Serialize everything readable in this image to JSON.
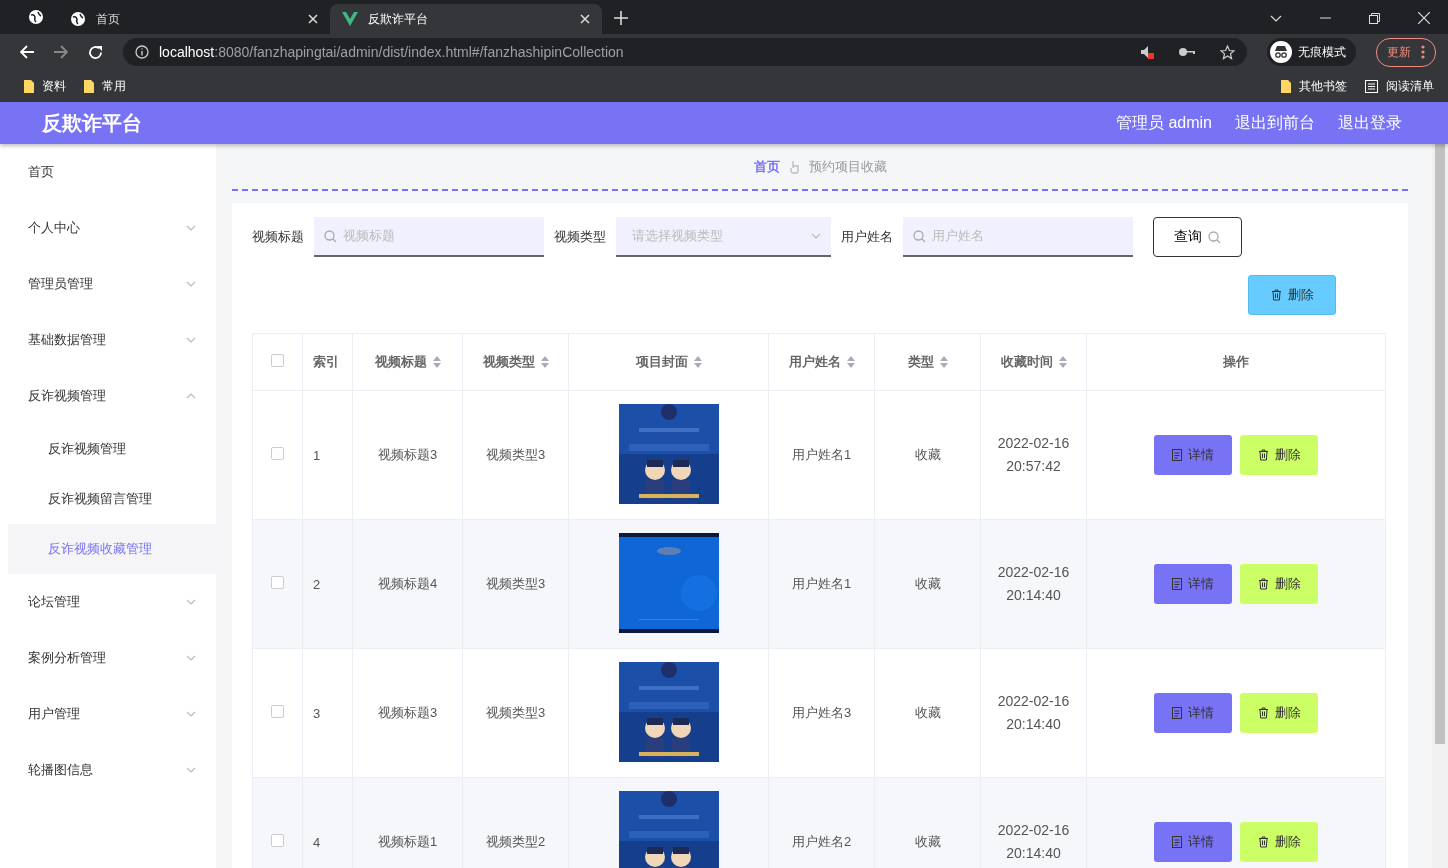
{
  "browser": {
    "tabs": [
      {
        "title": "首页",
        "selected": false
      },
      {
        "title": "反欺诈平台",
        "selected": true
      }
    ],
    "address": {
      "host": "localhost",
      "path": ":8080/fanzhapingtai/admin/dist/index.html#/fanzhashipinCollection"
    },
    "incognito": "无痕模式",
    "update": "更新",
    "bookmarks": [
      "资料",
      "常用"
    ],
    "other_bookmarks": "其他书签",
    "reading_list": "阅读清单"
  },
  "header": {
    "title": "反欺诈平台",
    "links": [
      "管理员 admin",
      "退出到前台",
      "退出登录"
    ]
  },
  "sidebar": {
    "items": [
      {
        "label": "首页",
        "expandable": false
      },
      {
        "label": "个人中心",
        "expandable": true,
        "expanded": false
      },
      {
        "label": "管理员管理",
        "expandable": true,
        "expanded": false
      },
      {
        "label": "基础数据管理",
        "expandable": true,
        "expanded": false
      },
      {
        "label": "反诈视频管理",
        "expandable": true,
        "expanded": true,
        "children": [
          {
            "label": "反诈视频管理",
            "selected": false
          },
          {
            "label": "反诈视频留言管理",
            "selected": false
          },
          {
            "label": "反诈视频收藏管理",
            "selected": true
          }
        ]
      },
      {
        "label": "论坛管理",
        "expandable": true,
        "expanded": false
      },
      {
        "label": "案例分析管理",
        "expandable": true,
        "expanded": false
      },
      {
        "label": "用户管理",
        "expandable": true,
        "expanded": false
      },
      {
        "label": "轮播图信息",
        "expandable": true,
        "expanded": false
      }
    ]
  },
  "breadcrumb": [
    "首页",
    "预约项目收藏"
  ],
  "filters": [
    {
      "label": "视频标题",
      "placeholder": "视频标题",
      "kind": "search"
    },
    {
      "label": "视频类型",
      "placeholder": "请选择视频类型",
      "kind": "select"
    },
    {
      "label": "用户姓名",
      "placeholder": "用户姓名",
      "kind": "search"
    }
  ],
  "query_button": "查询",
  "delete_button": "删除",
  "table": {
    "all_checked": false,
    "columns": [
      {
        "label": "索引",
        "sortable": false
      },
      {
        "label": "视频标题",
        "sortable": true
      },
      {
        "label": "视频类型",
        "sortable": true
      },
      {
        "label": "项目封面",
        "sortable": true
      },
      {
        "label": "用户姓名",
        "sortable": true
      },
      {
        "label": "类型",
        "sortable": true
      },
      {
        "label": "收藏时间",
        "sortable": true
      },
      {
        "label": "操作",
        "sortable": false
      }
    ],
    "rows": [
      {
        "checked": false,
        "index": "1",
        "title": "视频标题3",
        "type": "视频类型3",
        "cover": {
          "kind": "picture"
        },
        "user": "用户姓名1",
        "kind": "收藏",
        "time": [
          "2022-02-16",
          "20:57:42"
        ],
        "actions": [
          "详情",
          "删除"
        ]
      },
      {
        "checked": false,
        "index": "2",
        "title": "视频标题4",
        "type": "视频类型3",
        "cover": {
          "kind": "picture"
        },
        "user": "用户姓名1",
        "kind": "收藏",
        "time": [
          "2022-02-16",
          "20:14:40"
        ],
        "actions": [
          "详情",
          "删除"
        ]
      },
      {
        "checked": false,
        "index": "3",
        "title": "视频标题3",
        "type": "视频类型3",
        "cover": {
          "kind": "picture"
        },
        "user": "用户姓名3",
        "kind": "收藏",
        "time": [
          "2022-02-16",
          "20:14:40"
        ],
        "actions": [
          "详情",
          "删除"
        ]
      },
      {
        "checked": false,
        "index": "4",
        "title": "视频标题1",
        "type": "视频类型2",
        "cover": {
          "kind": "picture"
        },
        "user": "用户姓名2",
        "kind": "收藏",
        "time": [
          "2022-02-16",
          "20:14:40"
        ],
        "actions": [
          "详情",
          "删除"
        ]
      }
    ]
  }
}
